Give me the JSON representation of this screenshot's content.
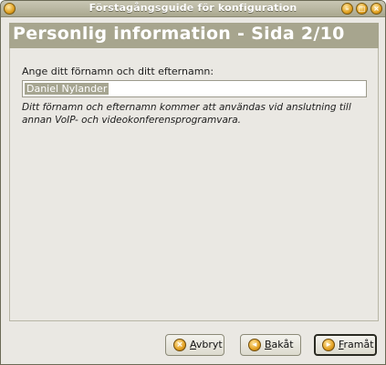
{
  "window": {
    "title": "Förstagångsguide för konfiguration"
  },
  "header": {
    "title": "Personlig information - Sida 2/10"
  },
  "form": {
    "name_label": "Ange ditt förnamn och ditt efternamn:",
    "name_value": "Daniel Nylander",
    "hint": "Ditt förnamn och efternamn kommer att användas vid anslutning till annan VoIP- och videokonferensprogramvara."
  },
  "buttons": {
    "cancel": "Avbryt",
    "back": "Bakåt",
    "next": "Framåt"
  }
}
